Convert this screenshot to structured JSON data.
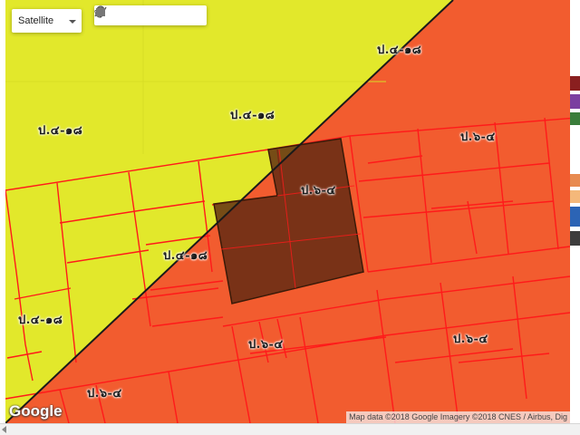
{
  "map": {
    "type_control": {
      "selected": "Satellite",
      "caret_icon": "chevron-down-icon"
    },
    "drawing_tools": [
      {
        "id": "pan",
        "icon": "hand-icon"
      },
      {
        "id": "marker",
        "icon": "map-pin-icon"
      },
      {
        "id": "polyline",
        "icon": "polyline-icon"
      },
      {
        "id": "rectangle",
        "icon": "rectangle-icon"
      },
      {
        "id": "circle",
        "icon": "circle-icon"
      },
      {
        "id": "polygon",
        "icon": "polygon-icon"
      }
    ],
    "zone_labels": [
      {
        "id": "upper-right",
        "text": "ป.๔-๑๘"
      },
      {
        "id": "upper-center",
        "text": "ป.๔-๑๘"
      },
      {
        "id": "upper-left",
        "text": "ป.๔-๑๘"
      },
      {
        "id": "right-upper",
        "text": "ป.๖-๔"
      },
      {
        "id": "selected-parcel",
        "text": "ป.๖-๔"
      },
      {
        "id": "middle",
        "text": "ป.๔-๑๘"
      },
      {
        "id": "left-lower",
        "text": "ป.๔-๑๘"
      },
      {
        "id": "center-lower",
        "text": "ป.๖-๔"
      },
      {
        "id": "right-lower",
        "text": "ป.๖-๔"
      },
      {
        "id": "bottom-left",
        "text": "ป.๖-๔"
      }
    ],
    "colors": {
      "yellow_zone": "#e2e82b",
      "orange_zone": "#f25c2f",
      "parcel_line": "#ff1a1a",
      "boundary_line": "#1a1a1a",
      "selected_parcel": "#5e2a12"
    },
    "google_logo": "Google",
    "attribution": "Map data ©2018 Google Imagery ©2018 CNES / Airbus, Dig"
  },
  "side_panel_colors": [
    "#8a1f1f",
    "#7b3fa0",
    "#3a7d3a",
    "#e88a4f",
    "#f4b87a",
    "#2c64b5",
    "#3d3d3d"
  ]
}
